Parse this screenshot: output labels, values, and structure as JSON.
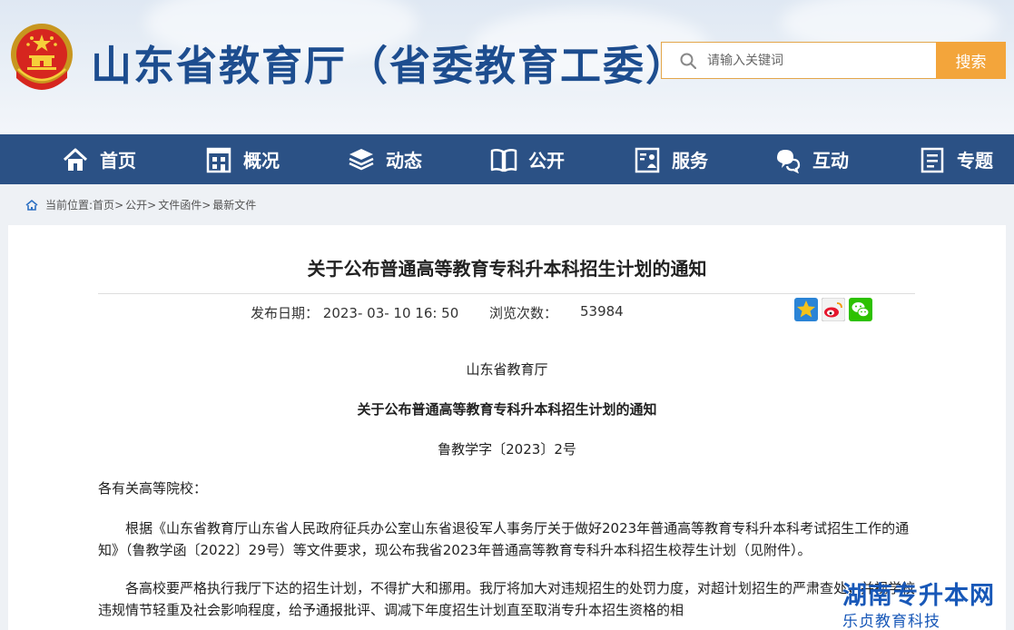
{
  "header": {
    "site_title": "山东省教育厅（省委教育工委）",
    "search_placeholder": "请输入关键词",
    "search_button": "搜索"
  },
  "nav": {
    "items": [
      {
        "label": "首页",
        "icon": "home-icon"
      },
      {
        "label": "概况",
        "icon": "building-icon"
      },
      {
        "label": "动态",
        "icon": "layers-icon"
      },
      {
        "label": "公开",
        "icon": "book-icon"
      },
      {
        "label": "服务",
        "icon": "service-icon"
      },
      {
        "label": "互动",
        "icon": "chat-icon"
      },
      {
        "label": "专题",
        "icon": "document-icon"
      }
    ]
  },
  "breadcrumb": {
    "prefix": "当前位置:",
    "items": [
      "首页",
      "公开",
      "文件函件",
      "最新文件"
    ],
    "separator": ">"
  },
  "article": {
    "title": "关于公布普通高等教育专科升本科招生计划的通知",
    "publish_label": "发布日期：",
    "publish_date": "2023- 03- 10 16: 50",
    "views_label": "浏览次数：",
    "views": "53984",
    "issuer": "山东省教育厅",
    "subtitle": "关于公布普通高等教育专科升本科招生计划的通知",
    "doc_number": "鲁教学字〔2023〕2号",
    "salutation": "各有关高等院校：",
    "paragraph_1": "根据《山东省教育厅山东省人民政府征兵办公室山东省退役军人事务厅关于做好2023年普通高等教育专科升本科考试招生工作的通知》（鲁教学函〔2022〕29号）等文件要求，现公布我省2023年普通高等教育专科升本科招生校荐生计划（见附件）。",
    "paragraph_2": "各高校要严格执行我厅下达的招生计划，不得扩大和挪用。我厅将加大对违规招生的处罚力度，对超计划招生的严肃查处，并视学校违规情节轻重及社会影响程度，给予通报批评、调减下年度招生计划直至取消专升本招生资格的相"
  },
  "share": [
    "qzone-icon",
    "weibo-icon",
    "wechat-icon"
  ],
  "watermark": {
    "main": "湖南专升本网",
    "sub": "乐贞教育科技"
  },
  "colors": {
    "brand_blue": "#2b5185",
    "title_blue": "#1d4d8f",
    "search_orange": "#f3a53b"
  }
}
